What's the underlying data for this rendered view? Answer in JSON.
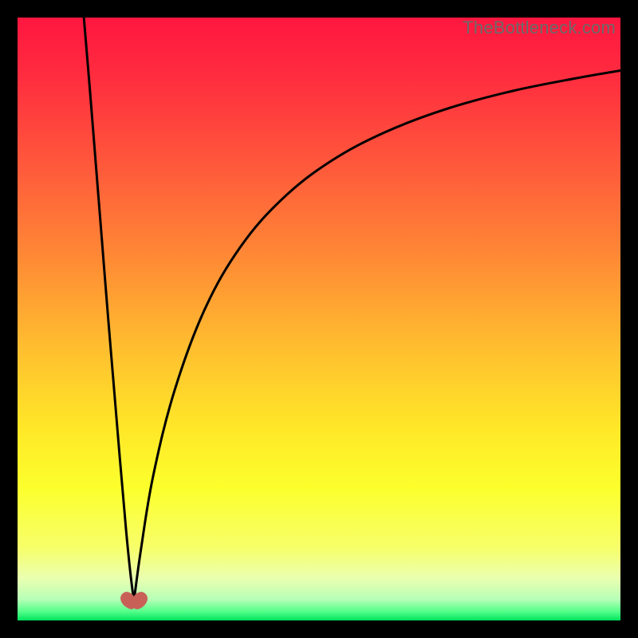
{
  "watermark": "TheBottleneck.com",
  "gradient": {
    "stops": [
      {
        "offset": 0.0,
        "color": "#ff163f"
      },
      {
        "offset": 0.1,
        "color": "#ff2d3f"
      },
      {
        "offset": 0.25,
        "color": "#ff5a3b"
      },
      {
        "offset": 0.4,
        "color": "#ff8a35"
      },
      {
        "offset": 0.55,
        "color": "#ffbf2f"
      },
      {
        "offset": 0.68,
        "color": "#ffe728"
      },
      {
        "offset": 0.78,
        "color": "#fcff2c"
      },
      {
        "offset": 0.88,
        "color": "#f7ff6a"
      },
      {
        "offset": 0.93,
        "color": "#eaffb0"
      },
      {
        "offset": 0.965,
        "color": "#b7ffb7"
      },
      {
        "offset": 0.985,
        "color": "#55ff8a"
      },
      {
        "offset": 1.0,
        "color": "#00e35d"
      }
    ]
  },
  "heart": {
    "cx": 0.193,
    "cy": 0.968,
    "scale": 0.026,
    "fill": "#c86058",
    "stroke": "#c86058"
  },
  "chart_data": {
    "type": "line",
    "title": "",
    "xlabel": "",
    "ylabel": "",
    "xlim": [
      0,
      1
    ],
    "ylim": [
      0,
      1
    ],
    "note": "Values are normalized plot-area coordinates (0,0 = top-left, 1,1 = bottom-right). Curve has two branches meeting at a cusp near the bottom.",
    "series": [
      {
        "name": "left-branch",
        "x": [
          0.11,
          0.12,
          0.13,
          0.14,
          0.15,
          0.16,
          0.17,
          0.18,
          0.187,
          0.193
        ],
        "y": [
          0.0,
          0.12,
          0.245,
          0.37,
          0.495,
          0.615,
          0.735,
          0.85,
          0.92,
          0.968
        ]
      },
      {
        "name": "right-branch",
        "x": [
          0.193,
          0.205,
          0.225,
          0.26,
          0.31,
          0.37,
          0.44,
          0.52,
          0.61,
          0.71,
          0.82,
          0.93,
          1.0
        ],
        "y": [
          0.968,
          0.88,
          0.76,
          0.62,
          0.485,
          0.38,
          0.3,
          0.238,
          0.19,
          0.152,
          0.122,
          0.1,
          0.088
        ]
      }
    ],
    "cusp": {
      "x": 0.193,
      "y": 0.968
    }
  }
}
